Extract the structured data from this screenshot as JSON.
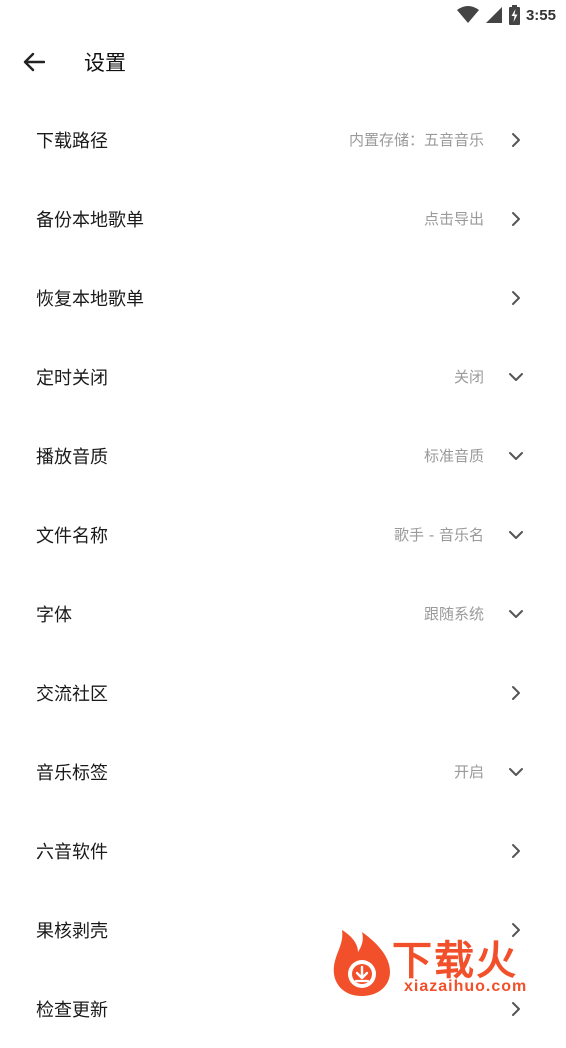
{
  "status_bar": {
    "time": "3:55"
  },
  "app_bar": {
    "title": "设置"
  },
  "settings": [
    {
      "label": "下载路径",
      "value": "内置存储：五音音乐",
      "indicator": "chevron-right"
    },
    {
      "label": "备份本地歌单",
      "value": "点击导出",
      "indicator": "chevron-right"
    },
    {
      "label": "恢复本地歌单",
      "value": "",
      "indicator": "chevron-right"
    },
    {
      "label": "定时关闭",
      "value": "关闭",
      "indicator": "chevron-down"
    },
    {
      "label": "播放音质",
      "value": "标准音质",
      "indicator": "chevron-down"
    },
    {
      "label": "文件名称",
      "value": "歌手 - 音乐名",
      "indicator": "chevron-down"
    },
    {
      "label": "字体",
      "value": "跟随系统",
      "indicator": "chevron-down"
    },
    {
      "label": "交流社区",
      "value": "",
      "indicator": "chevron-right"
    },
    {
      "label": "音乐标签",
      "value": "开启",
      "indicator": "chevron-down"
    },
    {
      "label": "六音软件",
      "value": "",
      "indicator": "chevron-right"
    },
    {
      "label": "果核剥壳",
      "value": "",
      "indicator": "chevron-right"
    },
    {
      "label": "检查更新",
      "value": "",
      "indicator": "chevron-right"
    }
  ],
  "watermark": {
    "title": "下载火",
    "url": "xiazaihuo.com"
  },
  "colors": {
    "accent": "#f2502a",
    "secondary_text": "#9a9a9a",
    "icon": "#555555"
  }
}
